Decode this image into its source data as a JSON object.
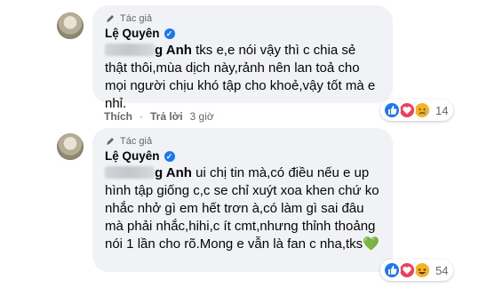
{
  "comments": [
    {
      "role_label": "Tác giả",
      "author": "Lệ Quyên",
      "mention_visible": "g Anh",
      "text": " tks e,e nói vậy thì c chia sẻ thật thôi,mùa dịch này,rảnh nên lan toả cho mọi người chịu khó tập cho khoẻ,vậy tốt mà e nhỉ.",
      "like_label": "Thích",
      "reply_label": "Trả lời",
      "time": "3 giờ",
      "reaction_count": "14",
      "reaction_icons": [
        "like-icon",
        "love-icon",
        "sad-icon"
      ]
    },
    {
      "role_label": "Tác giả",
      "author": "Lệ Quyên",
      "mention_visible": "g Anh",
      "text": " ui chị tin mà,có điều nếu e up hình tập giống c,c se chỉ xuýt xoa khen chứ ko nhắc nhở gì em hết trơn à,có làm gì sai đâu mà phải nhắc,hihi,c ít cmt,nhưng thỉnh thoảng nói 1 lần cho rõ.Mong e vẫn là fan c nha,tks",
      "emoji": "💚",
      "reaction_count": "54",
      "reaction_icons": [
        "like-icon",
        "love-icon",
        "haha-icon"
      ]
    }
  ],
  "colors": {
    "like": "#1877f2",
    "love": "#f33e58",
    "sad": "#f7b125",
    "haha": "#f7b125",
    "bubble": "#f0f2f5"
  }
}
